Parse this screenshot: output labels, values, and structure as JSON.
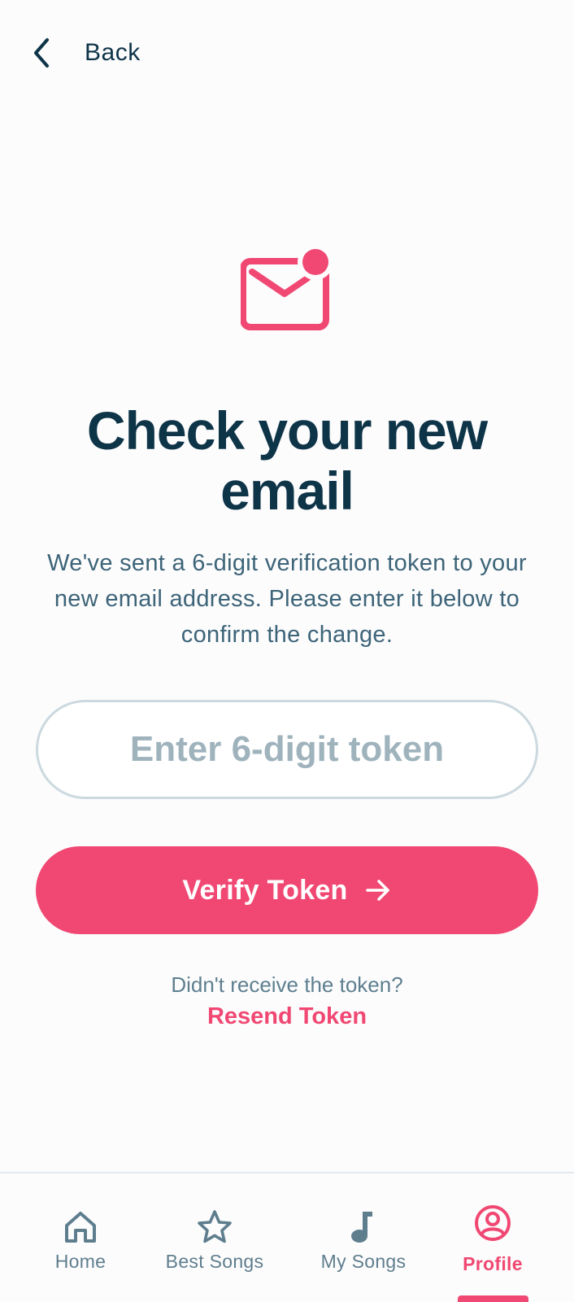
{
  "header": {
    "back_label": "Back"
  },
  "main": {
    "title": "Check your new email",
    "subtitle": "We've sent a 6-digit verification token to your new email address. Please enter it below to confirm the change.",
    "token_input": {
      "placeholder": "Enter 6-digit token",
      "value": ""
    },
    "verify_button_label": "Verify Token",
    "resend_prompt": "Didn't receive the token?",
    "resend_link": "Resend Token"
  },
  "tabbar": {
    "tabs": [
      {
        "label": "Home",
        "icon": "home-icon"
      },
      {
        "label": "Best Songs",
        "icon": "star-icon"
      },
      {
        "label": "My Songs",
        "icon": "music-note-icon"
      },
      {
        "label": "Profile",
        "icon": "profile-icon",
        "active": true
      }
    ]
  },
  "colors": {
    "accent": "#f04872",
    "heading": "#0e3448",
    "body_text": "#3d6478",
    "muted": "#5f7e8d",
    "input_border": "#ccd9df"
  }
}
